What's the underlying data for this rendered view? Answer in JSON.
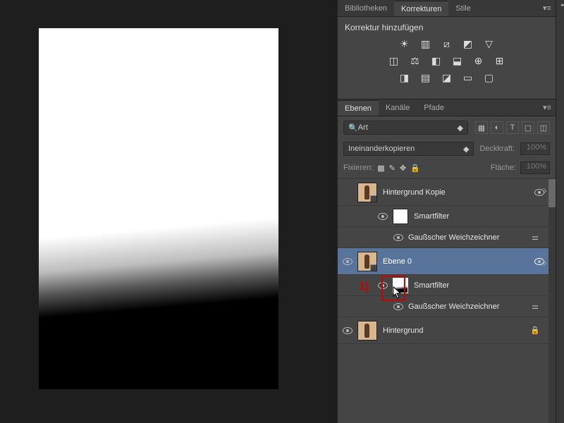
{
  "top_tabs": {
    "bibliotheken": "Bibliotheken",
    "korrekturen": "Korrekturen",
    "stile": "Stile"
  },
  "korrekturen": {
    "title": "Korrektur hinzufügen"
  },
  "layer_tabs": {
    "ebenen": "Ebenen",
    "kanaele": "Kanäle",
    "pfade": "Pfade"
  },
  "search": {
    "placeholder": "Art"
  },
  "blend": {
    "mode": "Ineinanderkopieren",
    "opacity_label": "Deckkraft:",
    "opacity": "100%"
  },
  "lock": {
    "label": "Fixieren:",
    "fill_label": "Fläche:",
    "fill": "100%"
  },
  "layers": [
    {
      "name": "Hintergrund Kopie"
    },
    {
      "name": "Smartfilter"
    },
    {
      "name": "Gaußscher Weichzeichner"
    },
    {
      "name": "Ebene 0"
    },
    {
      "name": "Smartfilter"
    },
    {
      "name": "Gaußscher Weichzeichner"
    },
    {
      "name": "Hintergrund"
    }
  ],
  "annotation": {
    "num": "1)"
  }
}
